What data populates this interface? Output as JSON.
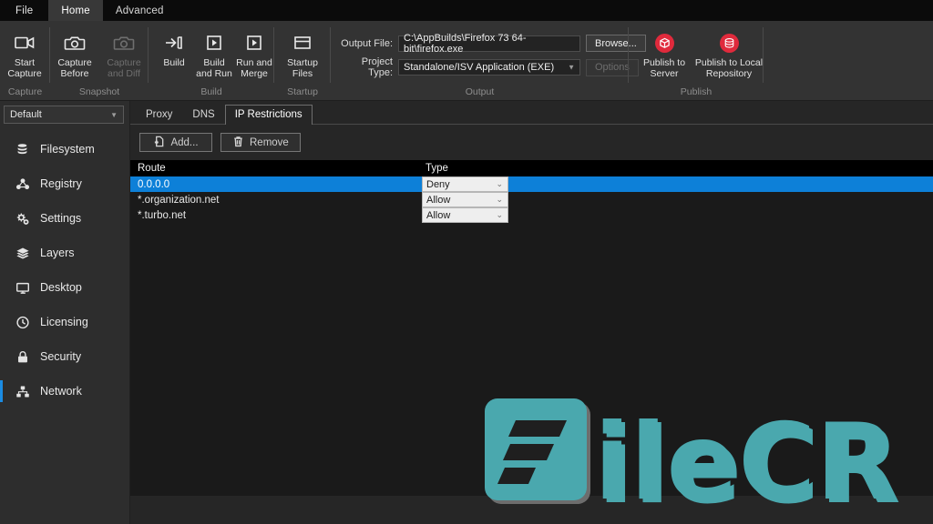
{
  "titlebar": {
    "tabs": [
      {
        "label": "File",
        "selected": false
      },
      {
        "label": "Home",
        "selected": true
      },
      {
        "label": "Advanced",
        "selected": false
      }
    ]
  },
  "ribbon": {
    "groups": [
      {
        "title": "Capture",
        "buttons": [
          {
            "label": "Start\nCapture",
            "icon": "video-camera-icon",
            "disabled": false
          }
        ]
      },
      {
        "title": "Snapshot",
        "buttons": [
          {
            "label": "Capture\nBefore",
            "icon": "camera-icon",
            "disabled": false
          },
          {
            "label": "Capture\nand Diff",
            "icon": "camera-icon",
            "disabled": true
          }
        ]
      },
      {
        "title": "Build",
        "buttons": [
          {
            "label": "Build",
            "icon": "build-arrow-icon",
            "disabled": false
          },
          {
            "label": "Build\nand Run",
            "icon": "play-box-icon",
            "disabled": false
          },
          {
            "label": "Run and\nMerge",
            "icon": "play-box-icon",
            "disabled": false
          }
        ]
      },
      {
        "title": "Startup",
        "buttons": [
          {
            "label": "Startup\nFiles",
            "icon": "window-pane-icon",
            "disabled": false
          }
        ]
      }
    ],
    "output": {
      "title": "Output",
      "file_label": "Output File:",
      "file_value": "C:\\AppBuilds\\Firefox 73 64-bit\\firefox.exe",
      "browse_label": "Browse...",
      "project_label": "Project Type:",
      "project_value": "Standalone/ISV Application (EXE)",
      "options_label": "Options"
    },
    "publish": {
      "title": "Publish",
      "buttons": [
        {
          "label": "Publish to\nServer",
          "icon": "publish-server-icon",
          "color": "#e02a3c"
        },
        {
          "label": "Publish to Local\nRepository",
          "icon": "publish-repository-icon",
          "color": "#e02a3c"
        }
      ]
    }
  },
  "sidebar": {
    "profile_value": "Default",
    "items": [
      {
        "label": "Filesystem",
        "icon": "database-icon",
        "active": false
      },
      {
        "label": "Registry",
        "icon": "registry-icon",
        "active": false
      },
      {
        "label": "Settings",
        "icon": "gears-icon",
        "active": false
      },
      {
        "label": "Layers",
        "icon": "layers-icon",
        "active": false
      },
      {
        "label": "Desktop",
        "icon": "monitor-icon",
        "active": false
      },
      {
        "label": "Licensing",
        "icon": "clock-icon",
        "active": false
      },
      {
        "label": "Security",
        "icon": "lock-icon",
        "active": false
      },
      {
        "label": "Network",
        "icon": "network-icon",
        "active": true
      }
    ]
  },
  "content": {
    "tabs": [
      {
        "label": "Proxy",
        "selected": false
      },
      {
        "label": "DNS",
        "selected": false
      },
      {
        "label": "IP Restrictions",
        "selected": true
      }
    ],
    "toolbar": {
      "add_label": "Add...",
      "remove_label": "Remove"
    },
    "table": {
      "columns": [
        "Route",
        "Type"
      ],
      "rows": [
        {
          "route": "0.0.0.0",
          "type": "Deny",
          "selected": true
        },
        {
          "route": "*.organization.net",
          "type": "Allow",
          "selected": false
        },
        {
          "route": "*.turbo.net",
          "type": "Allow",
          "selected": false
        }
      ],
      "type_options": [
        "Allow",
        "Deny"
      ]
    }
  },
  "watermark": {
    "text_f": "F",
    "text_rest": "ileCR",
    "color": "#4aa8ae"
  },
  "colors": {
    "accent_blue": "#0d80d8",
    "publish_red": "#e02a3c",
    "ribbon_bg": "#333333",
    "sidebar_bg": "#2d2d2d",
    "content_bg": "#262626",
    "table_bg": "#1a1a1a"
  }
}
